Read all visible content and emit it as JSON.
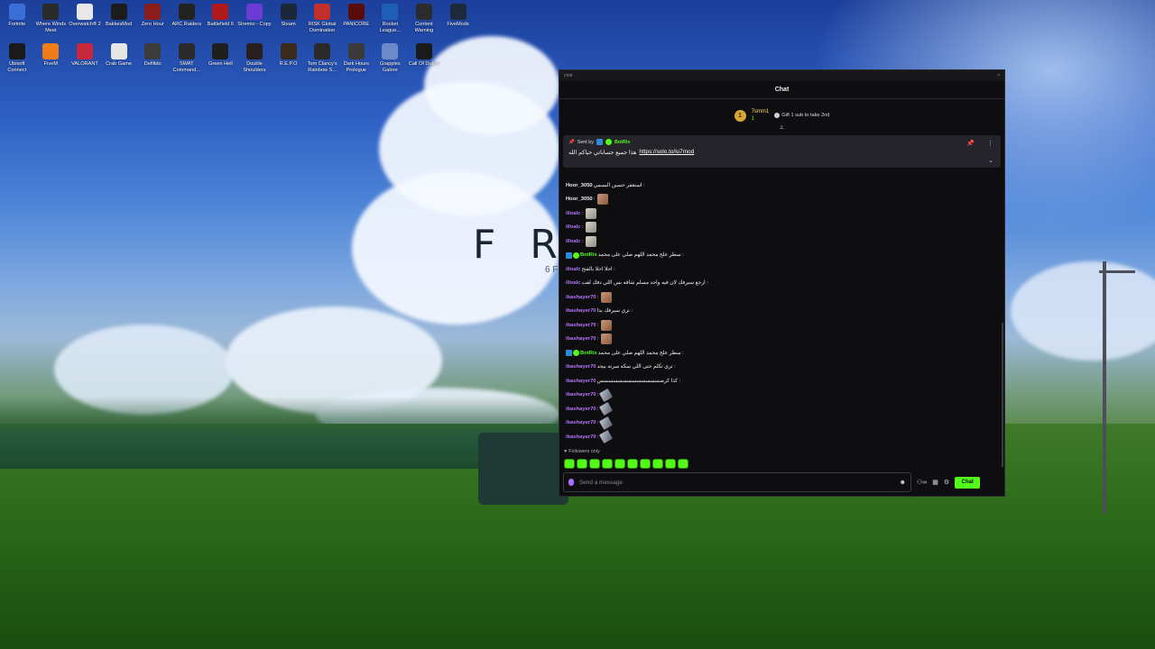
{
  "desktop": {
    "icons_row1": [
      {
        "label": "Fortnite",
        "icon": "fortnite-icon",
        "color": "#3a6fd8"
      },
      {
        "label": "Where Winds Meet",
        "icon": "where-winds-meet-icon",
        "color": "#2a2a2a"
      },
      {
        "label": "Overwatch® 2",
        "icon": "overwatch-icon",
        "color": "#e8e8e8"
      },
      {
        "label": "BakkesMod",
        "icon": "bakkesmod-icon",
        "color": "#1c1c1c"
      },
      {
        "label": "Zero Hour",
        "icon": "zero-hour-icon",
        "color": "#8a1c1c"
      },
      {
        "label": "ARC Raiders",
        "icon": "arc-raiders-icon",
        "color": "#222222"
      },
      {
        "label": "Battlefield 6",
        "icon": "battlefield-icon",
        "color": "#b11a1a"
      },
      {
        "label": "Stremio - Copy",
        "icon": "stremio-icon",
        "color": "#6b3bd6"
      },
      {
        "label": "Steam",
        "icon": "steam-icon",
        "color": "#1b2838"
      },
      {
        "label": "RISK Global Domination",
        "icon": "risk-icon",
        "color": "#c2302c"
      },
      {
        "label": "PANICORE",
        "icon": "panicore-icon",
        "color": "#5a0c0c"
      },
      {
        "label": "Rocket League...",
        "icon": "rocket-league-icon",
        "color": "#1f5fb8"
      },
      {
        "label": "Content Warning",
        "icon": "content-warning-icon",
        "color": "#2c2c2c"
      },
      {
        "label": "FiveMods",
        "icon": "fivemods-icon",
        "color": "#1e2a3a"
      }
    ],
    "icons_row2": [
      {
        "label": "Ubisoft Connect",
        "icon": "ubisoft-icon",
        "color": "#1a1a1a"
      },
      {
        "label": "FiveM",
        "icon": "fivem-icon",
        "color": "#f07d1a"
      },
      {
        "label": "VALORANT",
        "icon": "valorant-icon",
        "color": "#c8283c"
      },
      {
        "label": "Crab Game",
        "icon": "crab-game-icon",
        "color": "#e6e6e6"
      },
      {
        "label": "Defiltdo",
        "icon": "defiltdo-icon",
        "color": "#3b3b3b"
      },
      {
        "label": "SWAT Command...",
        "icon": "swat-icon",
        "color": "#2b2b2b"
      },
      {
        "label": "Green Hell",
        "icon": "green-hell-icon",
        "color": "#1f1f1f"
      },
      {
        "label": "Double Shoulders",
        "icon": "double-shoulders-icon",
        "color": "#2a1f1f"
      },
      {
        "label": "R.E.P.O",
        "icon": "repo-icon",
        "color": "#3a2a1a"
      },
      {
        "label": "Tom Clancy's Rainbow S...",
        "icon": "rainbow-six-icon",
        "color": "#2a2a2a"
      },
      {
        "label": "Dark Hours Prologue",
        "icon": "dark-hours-icon",
        "color": "#3a3a3a"
      },
      {
        "label": "Grapples Galore",
        "icon": "grapples-galore-icon",
        "color": "#6b8ac8"
      },
      {
        "label": "Call Of Duty®",
        "icon": "call-of-duty-icon",
        "color": "#1a1a1a"
      }
    ]
  },
  "wallpaper": {
    "text": "F R",
    "subtext": "6 F"
  },
  "window": {
    "title": "chat",
    "close": "×"
  },
  "chat": {
    "header": "Chat",
    "gift": {
      "rank": "1",
      "gifter_name": "7smm1",
      "gifter_count": "1",
      "text": "Gift 1 sub to take 2nd"
    },
    "pinned": {
      "sent_by": "Sent by",
      "author": "BotRix",
      "message": "هذا جميع حساباتي حياكم الله",
      "link": "https://solo.to/lu7mod"
    },
    "messages": [
      {
        "user": "Hoor_3050",
        "user_color": "white",
        "text": ": استغفر حسين البسمي"
      },
      {
        "user": "Hoor_3050",
        "user_color": "white",
        "text": ":",
        "emote": "face"
      },
      {
        "user": "illoalc",
        "user_color": "purple",
        "text": ":",
        "emote": "doll"
      },
      {
        "user": "illoalc",
        "user_color": "purple",
        "text": ":",
        "emote": "doll"
      },
      {
        "user": "illoalc",
        "user_color": "purple",
        "text": ":",
        "emote": "doll"
      },
      {
        "user": "BotRix",
        "user_color": "green",
        "bot": true,
        "text": ": سطر علج محمد اللهم صلي علی محمد"
      },
      {
        "user": "illoalc",
        "user_color": "purple",
        "text": ": احلا احلا بالفتح"
      },
      {
        "user": "illoalc",
        "user_color": "purple",
        "text": ": ارجع سيرفك لان فيه واحد مسلم شافه بس اللي دفك لفت"
      },
      {
        "user": "ibashayer70",
        "user_color": "purple",
        "text": ":",
        "emote": "face"
      },
      {
        "user": "ibashayer70",
        "user_color": "purple",
        "text": ": تري سيرفك بدا"
      },
      {
        "user": "ibashayer70",
        "user_color": "purple",
        "text": ":",
        "emote": "face"
      },
      {
        "user": "ibashayer70",
        "user_color": "purple",
        "text": ":",
        "emote": "face"
      },
      {
        "user": "BotRix",
        "user_color": "green",
        "bot": true,
        "text": ": سطر علج محمد اللهم صلي علی محمد"
      },
      {
        "user": "ibashayer70",
        "user_color": "purple",
        "text": ": ترى تكلم حتى اللي سكه سرته بيجد"
      },
      {
        "user": "ibashayer70",
        "user_color": "purple",
        "text": ": كذا كرصسسسسسسسسسسسسس"
      },
      {
        "user": "ibashayer70",
        "user_color": "purple",
        "text": ":",
        "emote": "pen"
      },
      {
        "user": "ibashayer70",
        "user_color": "purple",
        "text": ":",
        "emote": "pen"
      },
      {
        "user": "ibashayer70",
        "user_color": "purple",
        "text": ":",
        "emote": "pen"
      },
      {
        "user": "ibashayer70",
        "user_color": "purple",
        "text": ":",
        "emote": "pen"
      }
    ],
    "followers_only": "Followers only",
    "input_placeholder": "Send a message",
    "send_button": "Chat",
    "accent": "#53fc18"
  }
}
